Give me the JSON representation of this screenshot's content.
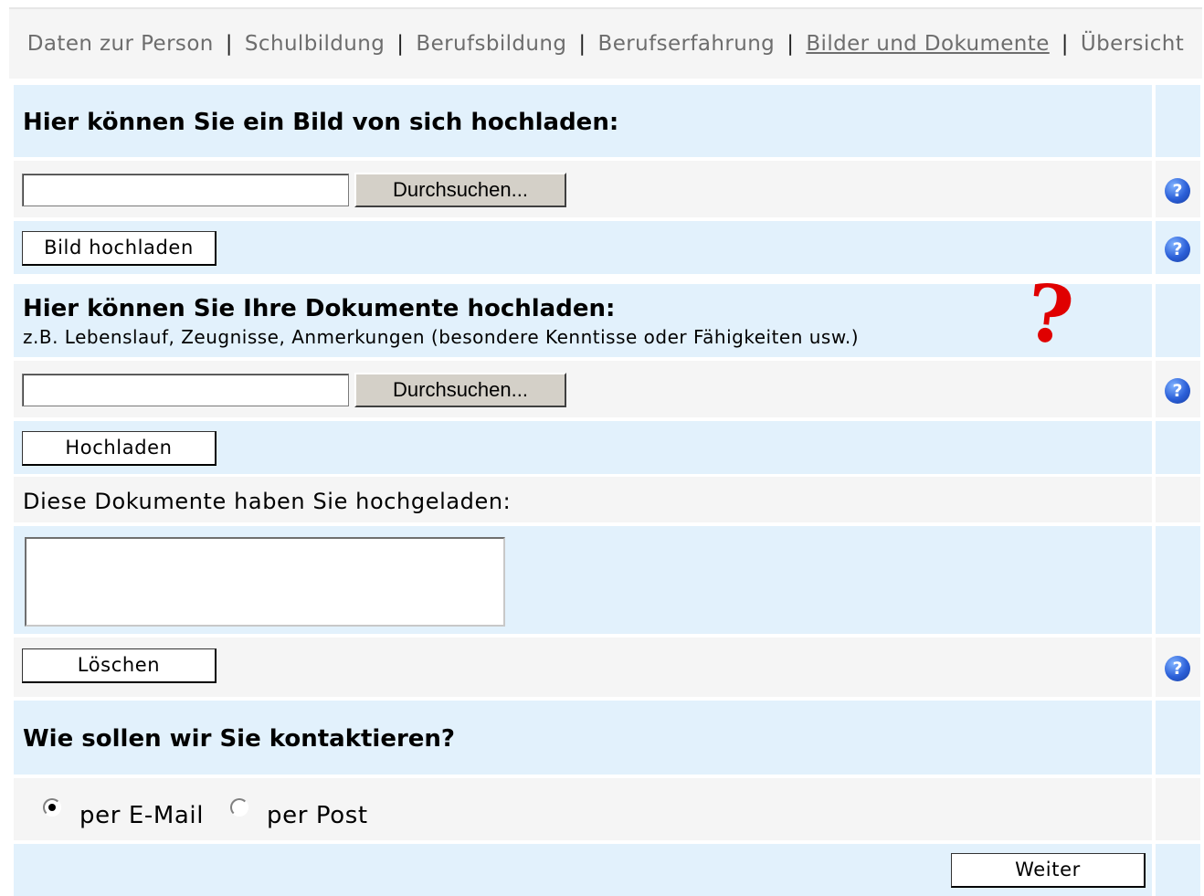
{
  "nav": {
    "items": [
      "Daten zur Person",
      "Schulbildung",
      "Berufsbildung",
      "Berufserfahrung",
      "Bilder und Dokumente",
      "Übersicht"
    ],
    "separator": "|",
    "active_index": 4
  },
  "photo_section": {
    "heading": "Hier können Sie ein Bild von sich hochladen:",
    "browse_label": "Durchsuchen...",
    "upload_label": "Bild hochladen"
  },
  "documents_section": {
    "heading": "Hier können Sie Ihre Dokumente hochladen:",
    "subheading": "z.B. Lebenslauf, Zeugnisse, Anmerkungen (besondere Kenntisse oder Fähigkeiten usw.)",
    "annotation_mark": "?",
    "browse_label": "Durchsuchen...",
    "upload_label": "Hochladen",
    "uploaded_label": "Diese Dokumente haben Sie hochgeladen:",
    "delete_label": "Löschen"
  },
  "contact_section": {
    "heading": "Wie sollen wir Sie kontaktieren?",
    "options": [
      {
        "label": "per E-Mail",
        "checked": true
      },
      {
        "label": "per Post",
        "checked": false
      }
    ]
  },
  "next_label": "Weiter",
  "help_icon_glyph": "?",
  "colors": {
    "row_blue": "#e2f1fc",
    "row_grey": "#f5f5f5",
    "help_icon": "#2b5fd8",
    "annotation": "#e00000"
  }
}
